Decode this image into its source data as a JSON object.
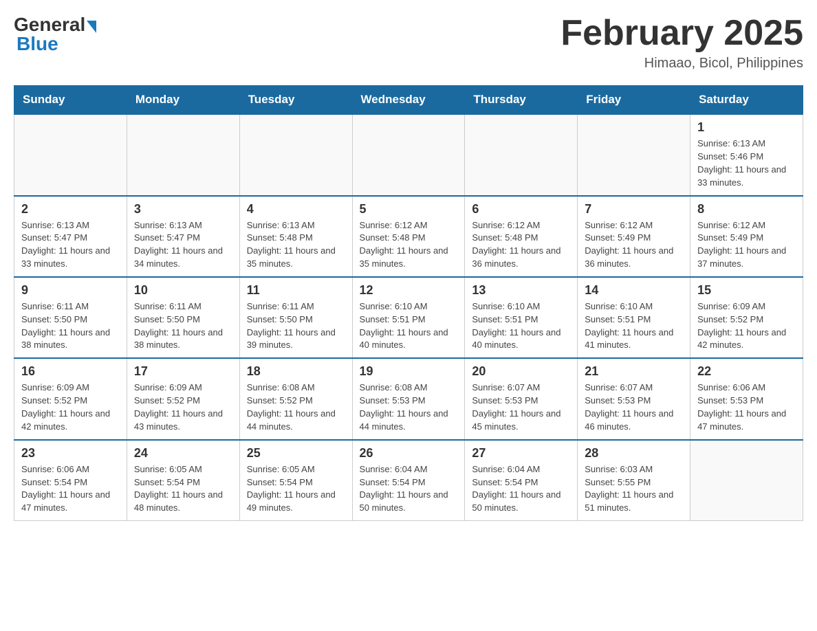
{
  "header": {
    "logo_general": "General",
    "logo_blue": "Blue",
    "month_title": "February 2025",
    "location": "Himaao, Bicol, Philippines"
  },
  "weekdays": [
    "Sunday",
    "Monday",
    "Tuesday",
    "Wednesday",
    "Thursday",
    "Friday",
    "Saturday"
  ],
  "weeks": [
    [
      {
        "day": "",
        "sunrise": "",
        "sunset": "",
        "daylight": ""
      },
      {
        "day": "",
        "sunrise": "",
        "sunset": "",
        "daylight": ""
      },
      {
        "day": "",
        "sunrise": "",
        "sunset": "",
        "daylight": ""
      },
      {
        "day": "",
        "sunrise": "",
        "sunset": "",
        "daylight": ""
      },
      {
        "day": "",
        "sunrise": "",
        "sunset": "",
        "daylight": ""
      },
      {
        "day": "",
        "sunrise": "",
        "sunset": "",
        "daylight": ""
      },
      {
        "day": "1",
        "sunrise": "Sunrise: 6:13 AM",
        "sunset": "Sunset: 5:46 PM",
        "daylight": "Daylight: 11 hours and 33 minutes."
      }
    ],
    [
      {
        "day": "2",
        "sunrise": "Sunrise: 6:13 AM",
        "sunset": "Sunset: 5:47 PM",
        "daylight": "Daylight: 11 hours and 33 minutes."
      },
      {
        "day": "3",
        "sunrise": "Sunrise: 6:13 AM",
        "sunset": "Sunset: 5:47 PM",
        "daylight": "Daylight: 11 hours and 34 minutes."
      },
      {
        "day": "4",
        "sunrise": "Sunrise: 6:13 AM",
        "sunset": "Sunset: 5:48 PM",
        "daylight": "Daylight: 11 hours and 35 minutes."
      },
      {
        "day": "5",
        "sunrise": "Sunrise: 6:12 AM",
        "sunset": "Sunset: 5:48 PM",
        "daylight": "Daylight: 11 hours and 35 minutes."
      },
      {
        "day": "6",
        "sunrise": "Sunrise: 6:12 AM",
        "sunset": "Sunset: 5:48 PM",
        "daylight": "Daylight: 11 hours and 36 minutes."
      },
      {
        "day": "7",
        "sunrise": "Sunrise: 6:12 AM",
        "sunset": "Sunset: 5:49 PM",
        "daylight": "Daylight: 11 hours and 36 minutes."
      },
      {
        "day": "8",
        "sunrise": "Sunrise: 6:12 AM",
        "sunset": "Sunset: 5:49 PM",
        "daylight": "Daylight: 11 hours and 37 minutes."
      }
    ],
    [
      {
        "day": "9",
        "sunrise": "Sunrise: 6:11 AM",
        "sunset": "Sunset: 5:50 PM",
        "daylight": "Daylight: 11 hours and 38 minutes."
      },
      {
        "day": "10",
        "sunrise": "Sunrise: 6:11 AM",
        "sunset": "Sunset: 5:50 PM",
        "daylight": "Daylight: 11 hours and 38 minutes."
      },
      {
        "day": "11",
        "sunrise": "Sunrise: 6:11 AM",
        "sunset": "Sunset: 5:50 PM",
        "daylight": "Daylight: 11 hours and 39 minutes."
      },
      {
        "day": "12",
        "sunrise": "Sunrise: 6:10 AM",
        "sunset": "Sunset: 5:51 PM",
        "daylight": "Daylight: 11 hours and 40 minutes."
      },
      {
        "day": "13",
        "sunrise": "Sunrise: 6:10 AM",
        "sunset": "Sunset: 5:51 PM",
        "daylight": "Daylight: 11 hours and 40 minutes."
      },
      {
        "day": "14",
        "sunrise": "Sunrise: 6:10 AM",
        "sunset": "Sunset: 5:51 PM",
        "daylight": "Daylight: 11 hours and 41 minutes."
      },
      {
        "day": "15",
        "sunrise": "Sunrise: 6:09 AM",
        "sunset": "Sunset: 5:52 PM",
        "daylight": "Daylight: 11 hours and 42 minutes."
      }
    ],
    [
      {
        "day": "16",
        "sunrise": "Sunrise: 6:09 AM",
        "sunset": "Sunset: 5:52 PM",
        "daylight": "Daylight: 11 hours and 42 minutes."
      },
      {
        "day": "17",
        "sunrise": "Sunrise: 6:09 AM",
        "sunset": "Sunset: 5:52 PM",
        "daylight": "Daylight: 11 hours and 43 minutes."
      },
      {
        "day": "18",
        "sunrise": "Sunrise: 6:08 AM",
        "sunset": "Sunset: 5:52 PM",
        "daylight": "Daylight: 11 hours and 44 minutes."
      },
      {
        "day": "19",
        "sunrise": "Sunrise: 6:08 AM",
        "sunset": "Sunset: 5:53 PM",
        "daylight": "Daylight: 11 hours and 44 minutes."
      },
      {
        "day": "20",
        "sunrise": "Sunrise: 6:07 AM",
        "sunset": "Sunset: 5:53 PM",
        "daylight": "Daylight: 11 hours and 45 minutes."
      },
      {
        "day": "21",
        "sunrise": "Sunrise: 6:07 AM",
        "sunset": "Sunset: 5:53 PM",
        "daylight": "Daylight: 11 hours and 46 minutes."
      },
      {
        "day": "22",
        "sunrise": "Sunrise: 6:06 AM",
        "sunset": "Sunset: 5:53 PM",
        "daylight": "Daylight: 11 hours and 47 minutes."
      }
    ],
    [
      {
        "day": "23",
        "sunrise": "Sunrise: 6:06 AM",
        "sunset": "Sunset: 5:54 PM",
        "daylight": "Daylight: 11 hours and 47 minutes."
      },
      {
        "day": "24",
        "sunrise": "Sunrise: 6:05 AM",
        "sunset": "Sunset: 5:54 PM",
        "daylight": "Daylight: 11 hours and 48 minutes."
      },
      {
        "day": "25",
        "sunrise": "Sunrise: 6:05 AM",
        "sunset": "Sunset: 5:54 PM",
        "daylight": "Daylight: 11 hours and 49 minutes."
      },
      {
        "day": "26",
        "sunrise": "Sunrise: 6:04 AM",
        "sunset": "Sunset: 5:54 PM",
        "daylight": "Daylight: 11 hours and 50 minutes."
      },
      {
        "day": "27",
        "sunrise": "Sunrise: 6:04 AM",
        "sunset": "Sunset: 5:54 PM",
        "daylight": "Daylight: 11 hours and 50 minutes."
      },
      {
        "day": "28",
        "sunrise": "Sunrise: 6:03 AM",
        "sunset": "Sunset: 5:55 PM",
        "daylight": "Daylight: 11 hours and 51 minutes."
      },
      {
        "day": "",
        "sunrise": "",
        "sunset": "",
        "daylight": ""
      }
    ]
  ]
}
